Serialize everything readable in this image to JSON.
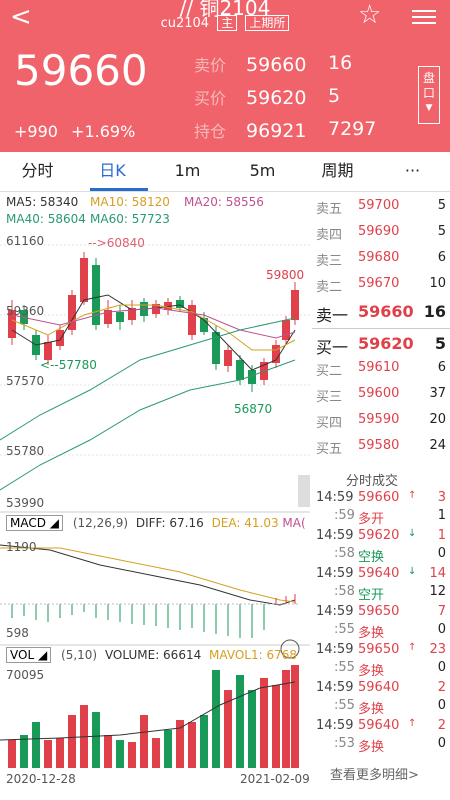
{
  "header": {
    "title": "// 铜2104",
    "contract": "cu2104",
    "tag_main": "主",
    "exchange": "上期所",
    "last_price": "59660",
    "change": "+990",
    "change_pct": "+1.69%",
    "ask_label": "卖价",
    "ask_price": "59660",
    "ask_vol": "16",
    "bid_label": "买价",
    "bid_price": "59620",
    "bid_vol": "5",
    "oi_label": "持仓",
    "oi": "96921",
    "oi_chg": "7297",
    "pan_label": "盘口"
  },
  "tabs": [
    "分时",
    "日K",
    "1m",
    "5m",
    "周期",
    "···"
  ],
  "ma_legend": {
    "ma5": "MA5: 58340",
    "ma10": "MA10: 58120",
    "ma20": "MA20: 58556",
    "ma40": "MA40: 58604",
    "ma60": "MA60: 57723"
  },
  "price_axis": [
    "61160",
    "59360",
    "57570",
    "55780",
    "53990"
  ],
  "annotations": {
    "high": "-->60840",
    "low": "<--57780",
    "recent_high": "59800",
    "recent_low": "56870"
  },
  "macd": {
    "label": "MACD",
    "params": "(12,26,9)",
    "diff": "DIFF: 67.16",
    "dea": "DEA: 41.03",
    "ma": "MA(",
    "top": "1190",
    "bottom": "598"
  },
  "vol": {
    "label": "VOL",
    "params": "(5,10)",
    "volume": "VOLUME: 66614",
    "mavol": "MAVOL1: 6768",
    "top": "70095"
  },
  "dates": {
    "start": "2020-12-28",
    "end": "2021-02-09"
  },
  "book": [
    {
      "name": "卖五",
      "price": "59700",
      "vol": "5"
    },
    {
      "name": "卖四",
      "price": "59690",
      "vol": "5"
    },
    {
      "name": "卖三",
      "price": "59680",
      "vol": "6"
    },
    {
      "name": "卖二",
      "price": "59670",
      "vol": "10"
    },
    {
      "name": "卖一",
      "price": "59660",
      "vol": "16"
    },
    {
      "name": "买一",
      "price": "59620",
      "vol": "5"
    },
    {
      "name": "买二",
      "price": "59610",
      "vol": "6"
    },
    {
      "name": "买三",
      "price": "59600",
      "vol": "37"
    },
    {
      "name": "买四",
      "price": "59590",
      "vol": "20"
    },
    {
      "name": "买五",
      "price": "59580",
      "vol": "24"
    }
  ],
  "trades_title": "分时成交",
  "trades": [
    {
      "time": "14:59",
      "price": "59660",
      "arrow": "↑",
      "vol": "3",
      "color": "#e0404a",
      "sec": ":59",
      "type": "多开",
      "oi": "1",
      "tcolor": "#e0404a"
    },
    {
      "time": "14:59",
      "price": "59620",
      "arrow": "↓",
      "vol": "1",
      "color": "#e0404a",
      "sec": ":58",
      "type": "空换",
      "oi": "0",
      "tcolor": "#1a9a58"
    },
    {
      "time": "14:59",
      "price": "59640",
      "arrow": "↓",
      "vol": "14",
      "color": "#e0404a",
      "sec": ":58",
      "type": "空开",
      "oi": "12",
      "tcolor": "#1a9a58"
    },
    {
      "time": "14:59",
      "price": "59650",
      "arrow": "",
      "vol": "7",
      "color": "#e0404a",
      "sec": ":55",
      "type": "多换",
      "oi": "0",
      "tcolor": "#e0404a"
    },
    {
      "time": "14:59",
      "price": "59650",
      "arrow": "↑",
      "vol": "23",
      "color": "#e0404a",
      "sec": ":55",
      "type": "多换",
      "oi": "0",
      "tcolor": "#e0404a"
    },
    {
      "time": "14:59",
      "price": "59640",
      "arrow": "",
      "vol": "2",
      "color": "#e0404a",
      "sec": ":55",
      "type": "多换",
      "oi": "0",
      "tcolor": "#e0404a"
    },
    {
      "time": "14:59",
      "price": "59640",
      "arrow": "↑",
      "vol": "2",
      "color": "#e0404a",
      "sec": ":53",
      "type": "多换",
      "oi": "0",
      "tcolor": "#e0404a"
    }
  ],
  "more_label": "查看更多明细>"
}
